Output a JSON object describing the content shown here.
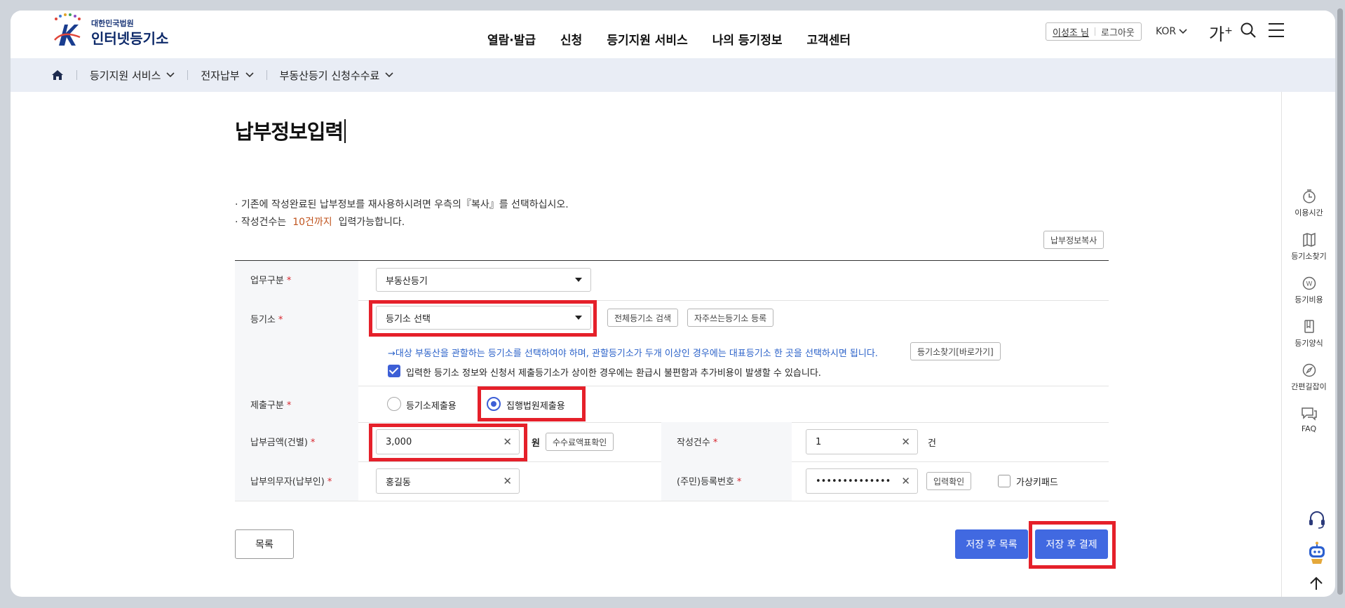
{
  "header": {
    "logo_sub": "대한민국법원",
    "logo_main": "인터넷등기소",
    "nav": [
      "열람·발급",
      "신청",
      "등기지원 서비스",
      "나의 등기정보",
      "고객센터"
    ],
    "user_name": "이성조 님",
    "logout": "로그아웃",
    "lang": "KOR",
    "font_size_label": "가"
  },
  "breadcrumb": [
    "등기지원 서비스",
    "전자납부",
    "부동산등기 신청수수료"
  ],
  "quick_menu": [
    "이용시간",
    "등기소찾기",
    "등기비용",
    "등기양식",
    "간편길잡이",
    "FAQ"
  ],
  "page": {
    "title": "납부정보입력",
    "notes": [
      "· 기존에 작성완료된 납부정보를 재사용하시려면 우측의『복사』를 선택하십시오.",
      "· 작성건수는",
      "10건까지",
      "입력가능합니다."
    ],
    "copy_button": "납부정보복사"
  },
  "form": {
    "work_type": {
      "label": "업무구분",
      "value": "부동산등기"
    },
    "registry": {
      "label": "등기소",
      "value": "등기소 선택",
      "search_all": "전체등기소 검색",
      "favorite": "자주쓰는등기소 등록",
      "help": "→대상 부동산을 관할하는 등기소를 선택하여야 하며, 관할등기소가 두개 이상인 경우에는 대표등기소 한 곳을 선택하시면 됩니다.",
      "find_link": "등기소찾기[바로가기]",
      "agree_text": "입력한 등기소 정보와 신청서 제출등기소가 상이한 경우에는 환급시 불편함과 추가비용이 발생할 수 있습니다."
    },
    "submit_type": {
      "label": "제출구분",
      "option1": "등기소제출용",
      "option2": "집행법원제출용"
    },
    "amount": {
      "label": "납부금액(건별)",
      "value": "3,000",
      "unit": "원",
      "fee_button": "수수료액표확인"
    },
    "count": {
      "label": "작성건수",
      "value": "1",
      "unit": "건"
    },
    "payer": {
      "label": "납부의무자(납부인)",
      "value": "홍길동"
    },
    "reg_no": {
      "label": "(주민)등록번호",
      "value": "••••••••••••••",
      "confirm": "입력확인",
      "keypad": "가상키패드"
    },
    "required_mark": "*"
  },
  "actions": {
    "list": "목록",
    "save_list": "저장 후 목록",
    "save_pay": "저장 후 결제"
  }
}
